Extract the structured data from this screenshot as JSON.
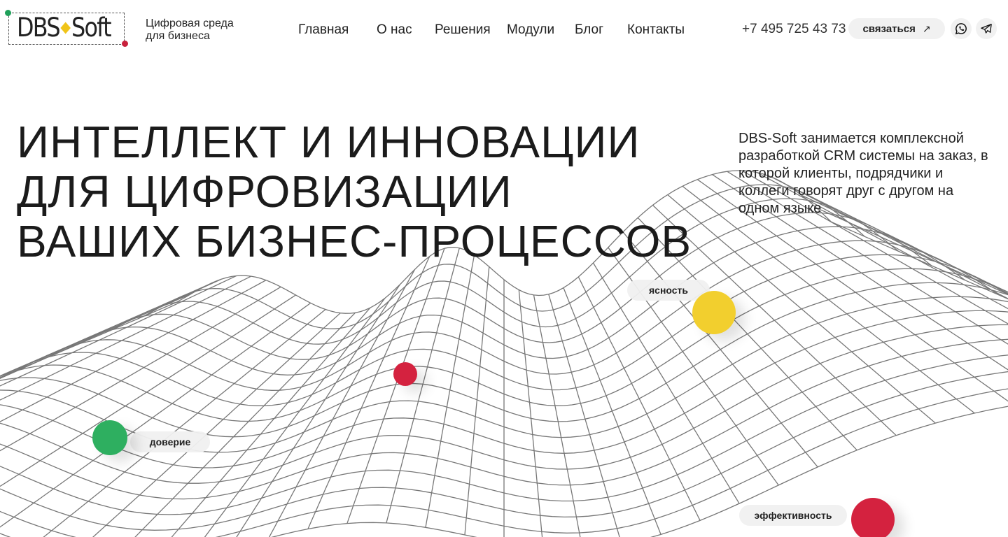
{
  "header": {
    "logo_text_left": "DBS",
    "logo_text_right": "Soft",
    "tagline_line1": "Цифровая среда",
    "tagline_line2": "для бизнеса",
    "nav": [
      "Главная",
      "О нас",
      "Решения",
      "Модули",
      "Блог",
      "Контакты"
    ],
    "phone": "+7 495 725 43 73",
    "contact_label": "связаться",
    "social_icons": [
      "whatsapp-icon",
      "telegram-icon"
    ]
  },
  "hero": {
    "title_lines": [
      "ИНТЕЛЛЕКТ И ИННОВАЦИИ",
      "ДЛЯ ЦИФРОВИЗАЦИИ",
      "ВАШИХ БИЗНЕС-ПРОЦЕССОВ"
    ],
    "description": "DBS-Soft занимается комплексной разработкой CRM системы на заказ, в которой клиенты, подрядчики и коллеги говорят друг с другом на одном языке"
  },
  "markers": {
    "clarity": "ясность",
    "trust": "доверие",
    "efficiency": "эффективность"
  },
  "colors": {
    "green": "#2eaf60",
    "red": "#d4223f",
    "yellow": "#f2cf2e",
    "mesh": "#777777"
  }
}
